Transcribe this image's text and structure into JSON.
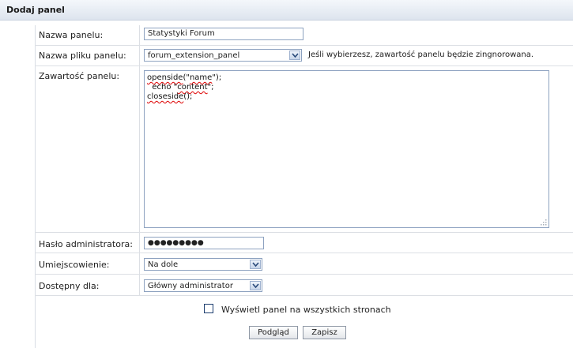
{
  "header": {
    "title": "Dodaj panel"
  },
  "form": {
    "panel_name": {
      "label": "Nazwa panelu:",
      "value": "Statystyki Forum"
    },
    "panel_file": {
      "label": "Nazwa pliku panelu:",
      "selected": "forum_extension_panel",
      "hint": "Jeśli wybierzesz, zawartość panelu będzie zingnorowana."
    },
    "panel_content": {
      "label": "Zawartość panelu:",
      "lines": {
        "l1_a": "openside",
        "l1_b": "(\"",
        "l1_c": "name",
        "l1_d": "\");",
        "l2_a": "  echo \"",
        "l2_b": "content",
        "l2_c": "\";",
        "l3_a": "closeside",
        "l3_b": "();"
      }
    },
    "admin_password": {
      "label": "Hasło administratora:",
      "value": "●●●●●●●●●"
    },
    "placement": {
      "label": "Umiejscowienie:",
      "selected": "Na dole"
    },
    "access": {
      "label": "Dostępny dla:",
      "selected": "Główny administrator"
    },
    "show_all_pages": {
      "label": "Wyświetl panel na wszystkich stronach",
      "checked": false
    }
  },
  "buttons": {
    "preview": "Podgląd",
    "save": "Zapisz"
  }
}
